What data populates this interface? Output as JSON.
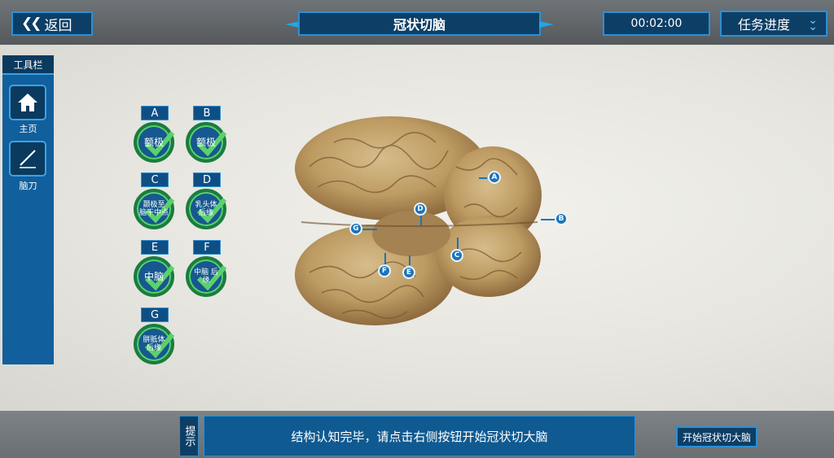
{
  "header": {
    "back_label": "返回",
    "title": "冠状切脑",
    "timer": "00:02:00",
    "progress_label": "任务进度"
  },
  "toolbar": {
    "title": "工具栏",
    "items": [
      {
        "label": "主页",
        "icon": "home-icon"
      },
      {
        "label": "脑刀",
        "icon": "knife-icon"
      }
    ]
  },
  "labels": [
    {
      "letter": "A",
      "text": "额极"
    },
    {
      "letter": "B",
      "text": "额极"
    },
    {
      "letter": "C",
      "text": "颞极至 脑干中点"
    },
    {
      "letter": "D",
      "text": "乳头体 后缘"
    },
    {
      "letter": "E",
      "text": "中脑"
    },
    {
      "letter": "F",
      "text": "中脑 后缘"
    },
    {
      "letter": "G",
      "text": "胼胝体 后缘"
    }
  ],
  "markers": [
    "A",
    "B",
    "C",
    "D",
    "E",
    "F",
    "G"
  ],
  "hint": {
    "tab": "提示",
    "text": "结构认知完毕，请点击右侧按钮开始冠状切大脑"
  },
  "start_button": "开始冠状切大脑",
  "colors": {
    "panel": "#0d3f66",
    "border": "#2f8fd1",
    "check": "#5bd16d"
  }
}
